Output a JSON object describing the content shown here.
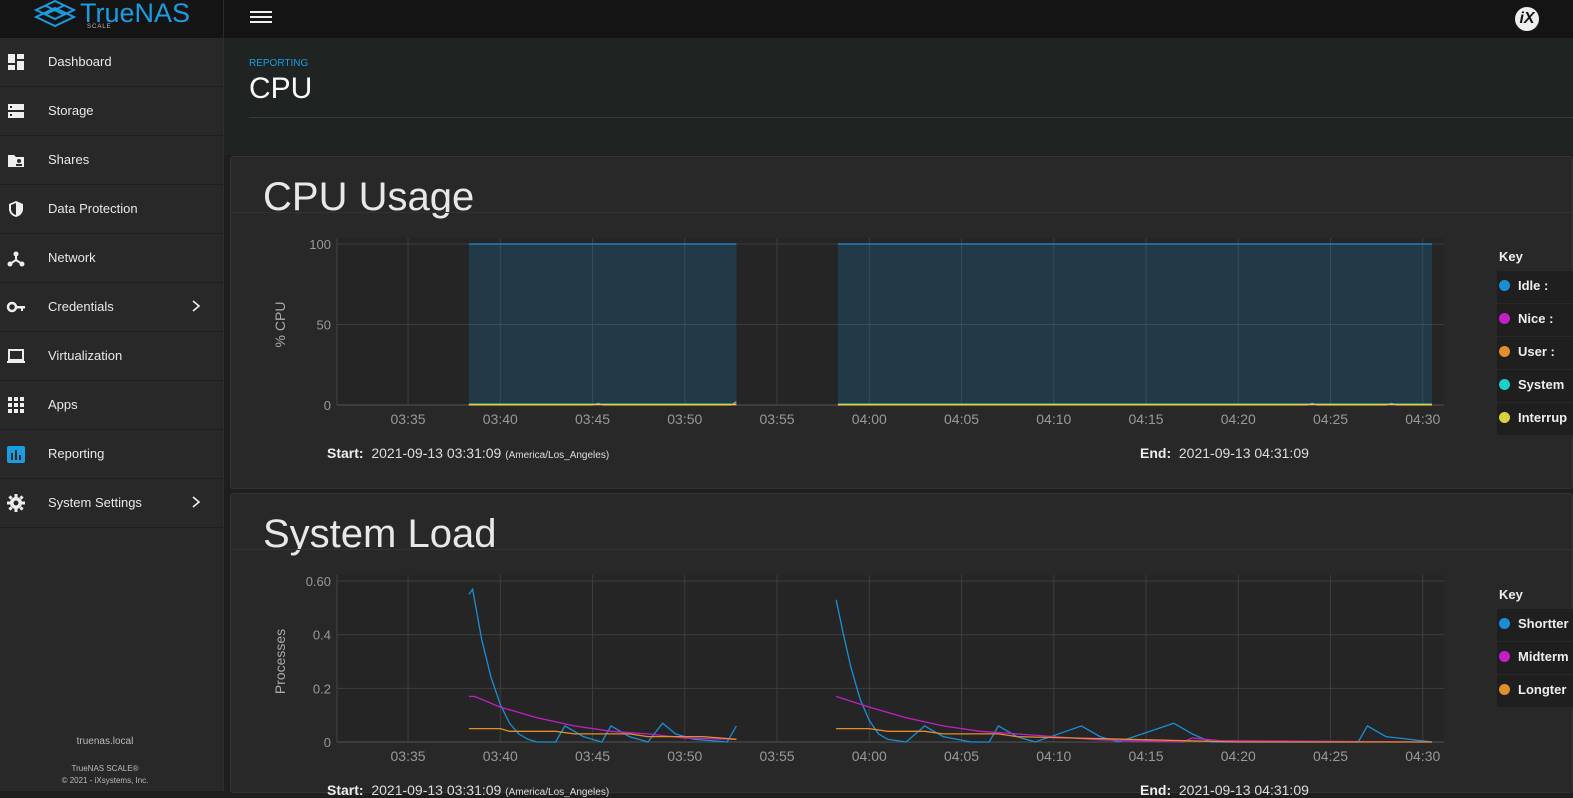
{
  "app": {
    "logo_text": "TrueNAS",
    "logo_sub": "SCALE",
    "vendor_logo": "iX sy"
  },
  "sidebar": {
    "items": [
      {
        "label": "Dashboard",
        "icon": "dashboard-icon"
      },
      {
        "label": "Storage",
        "icon": "storage-icon"
      },
      {
        "label": "Shares",
        "icon": "folder-share-icon"
      },
      {
        "label": "Data Protection",
        "icon": "shield-icon"
      },
      {
        "label": "Network",
        "icon": "network-icon"
      },
      {
        "label": "Credentials",
        "icon": "key-icon",
        "has_children": true
      },
      {
        "label": "Virtualization",
        "icon": "laptop-icon"
      },
      {
        "label": "Apps",
        "icon": "apps-grid-icon"
      },
      {
        "label": "Reporting",
        "icon": "bar-chart-icon",
        "active": true
      },
      {
        "label": "System Settings",
        "icon": "gear-icon",
        "has_children": true
      }
    ],
    "hostname": "truenas.local",
    "version": "TrueNAS SCALE®",
    "copyright": "© 2021 - iXsystems, Inc."
  },
  "header": {
    "breadcrumb": "REPORTING",
    "title": "CPU"
  },
  "colors": {
    "accent": "#1a9de0",
    "idle": "#1a8fd6",
    "nice": "#c21fc4",
    "user": "#e08f2c",
    "system": "#1ccfc9",
    "interrupt": "#d8d33a"
  },
  "cpu_card": {
    "title": "CPU Usage",
    "key_title": "Key",
    "keys": [
      {
        "label": "Idle :",
        "color": "#1a8fd6"
      },
      {
        "label": "Nice :",
        "color": "#c21fc4"
      },
      {
        "label": "User :",
        "color": "#e08f2c"
      },
      {
        "label": "System",
        "color": "#1ccfc9"
      },
      {
        "label": "Interrup",
        "color": "#d8d33a"
      }
    ],
    "start_label": "Start:",
    "start_value": "2021-09-13 03:31:09",
    "start_tz": "(America/Los_Angeles)",
    "end_label": "End:",
    "end_value": "2021-09-13 04:31:09"
  },
  "load_card": {
    "title": "System Load",
    "key_title": "Key",
    "keys": [
      {
        "label": "Shortter",
        "color": "#1a8fd6"
      },
      {
        "label": "Midterm",
        "color": "#c21fc4"
      },
      {
        "label": "Longter",
        "color": "#e08f2c"
      }
    ],
    "start_label": "Start:",
    "start_value": "2021-09-13 03:31:09",
    "start_tz": "(America/Los_Angeles)",
    "end_label": "End:",
    "end_value": "2021-09-13 04:31:09"
  },
  "chart_data": [
    {
      "type": "area",
      "title": "CPU Usage",
      "ylabel": "% CPU",
      "xlabel": "",
      "ylim": [
        0,
        100
      ],
      "yticks": [
        "100",
        "50",
        "0"
      ],
      "ytick_values": [
        100,
        50,
        0
      ],
      "xticks": [
        "03:35",
        "03:40",
        "03:45",
        "03:50",
        "03:55",
        "04:00",
        "04:05",
        "04:10",
        "04:15",
        "04:20",
        "04:25",
        "04:30"
      ],
      "xlim_minutes": [
        31.15,
        91.15
      ],
      "grid": true,
      "series": [
        {
          "name": "Idle",
          "color": "#1a8fd6",
          "segments": [
            [
              [
                38.3,
                100
              ],
              [
                52.8,
                100
              ]
            ],
            [
              [
                58.3,
                100
              ],
              [
                90.5,
                100
              ]
            ]
          ]
        },
        {
          "name": "Nice",
          "color": "#c21fc4",
          "segments": [
            [
              [
                38.3,
                0
              ],
              [
                52.8,
                0
              ]
            ],
            [
              [
                58.3,
                0
              ],
              [
                90.5,
                0
              ]
            ]
          ]
        },
        {
          "name": "User",
          "color": "#e08f2c",
          "segments": [
            [
              [
                38.3,
                0
              ],
              [
                45.0,
                0
              ],
              [
                45.3,
                1
              ],
              [
                45.6,
                0
              ],
              [
                52.5,
                0
              ],
              [
                52.8,
                2
              ]
            ],
            [
              [
                58.3,
                0
              ],
              [
                83.7,
                0
              ],
              [
                84.0,
                1
              ],
              [
                84.3,
                0
              ],
              [
                88.0,
                0
              ],
              [
                88.3,
                1
              ],
              [
                88.6,
                0
              ],
              [
                90.5,
                0
              ]
            ]
          ]
        },
        {
          "name": "System",
          "color": "#1ccfc9",
          "segments": [
            [
              [
                38.3,
                0.5
              ],
              [
                52.8,
                0.5
              ]
            ],
            [
              [
                58.3,
                0.5
              ],
              [
                90.5,
                0.5
              ]
            ]
          ]
        },
        {
          "name": "Interrupt",
          "color": "#d8d33a",
          "segments": [
            [
              [
                38.3,
                0.3
              ],
              [
                52.8,
                0.3
              ]
            ],
            [
              [
                58.3,
                0.3
              ],
              [
                90.5,
                0.3
              ]
            ]
          ]
        }
      ]
    },
    {
      "type": "line",
      "title": "System Load",
      "ylabel": "Processes",
      "xlabel": "",
      "ylim": [
        0,
        0.6
      ],
      "yticks": [
        "0.60",
        "0.4",
        "0.2",
        "0"
      ],
      "ytick_values": [
        0.6,
        0.4,
        0.2,
        0
      ],
      "xticks": [
        "03:35",
        "03:40",
        "03:45",
        "03:50",
        "03:55",
        "04:00",
        "04:05",
        "04:10",
        "04:15",
        "04:20",
        "04:25",
        "04:30"
      ],
      "xlim_minutes": [
        31.15,
        91.15
      ],
      "grid": true,
      "series": [
        {
          "name": "Shortterm",
          "color": "#1a8fd6",
          "segments": [
            [
              [
                38.3,
                0.55
              ],
              [
                38.5,
                0.57
              ],
              [
                39.0,
                0.38
              ],
              [
                39.5,
                0.24
              ],
              [
                40.0,
                0.14
              ],
              [
                40.5,
                0.07
              ],
              [
                41.0,
                0.03
              ],
              [
                41.5,
                0.01
              ],
              [
                42.0,
                0.0
              ],
              [
                43.0,
                0.0
              ],
              [
                43.5,
                0.06
              ],
              [
                44.5,
                0.02
              ],
              [
                45.5,
                0.0
              ],
              [
                46.0,
                0.06
              ],
              [
                47.0,
                0.02
              ],
              [
                48.0,
                0.0
              ],
              [
                48.8,
                0.07
              ],
              [
                49.5,
                0.03
              ],
              [
                50.5,
                0.01
              ],
              [
                52.3,
                0.0
              ],
              [
                52.8,
                0.06
              ]
            ],
            [
              [
                58.2,
                0.53
              ],
              [
                58.6,
                0.4
              ],
              [
                59.0,
                0.28
              ],
              [
                59.5,
                0.16
              ],
              [
                60.0,
                0.08
              ],
              [
                60.5,
                0.03
              ],
              [
                61.0,
                0.01
              ],
              [
                62.0,
                0.0
              ],
              [
                63.0,
                0.06
              ],
              [
                64.0,
                0.02
              ],
              [
                65.5,
                0.0
              ],
              [
                66.5,
                0.0
              ],
              [
                67.0,
                0.06
              ],
              [
                68.0,
                0.02
              ],
              [
                69.0,
                0.0
              ],
              [
                71.5,
                0.06
              ],
              [
                72.5,
                0.02
              ],
              [
                73.5,
                0.0
              ],
              [
                76.5,
                0.07
              ],
              [
                77.5,
                0.03
              ],
              [
                78.5,
                0.0
              ],
              [
                86.5,
                0.0
              ],
              [
                87.0,
                0.06
              ],
              [
                88.0,
                0.02
              ],
              [
                90.5,
                0.0
              ]
            ]
          ]
        },
        {
          "name": "Midterm",
          "color": "#c21fc4",
          "segments": [
            [
              [
                38.3,
                0.17
              ],
              [
                38.6,
                0.17
              ],
              [
                40.0,
                0.13
              ],
              [
                42.0,
                0.09
              ],
              [
                44.0,
                0.06
              ],
              [
                46.0,
                0.04
              ],
              [
                48.0,
                0.03
              ],
              [
                50.0,
                0.015
              ],
              [
                52.8,
                0.01
              ]
            ],
            [
              [
                58.2,
                0.17
              ],
              [
                60.0,
                0.13
              ],
              [
                62.0,
                0.09
              ],
              [
                64.0,
                0.06
              ],
              [
                66.0,
                0.04
              ],
              [
                68.0,
                0.03
              ],
              [
                70.0,
                0.02
              ],
              [
                72.0,
                0.01
              ],
              [
                74.0,
                0.005
              ],
              [
                77.0,
                0.0
              ],
              [
                77.5,
                0.015
              ],
              [
                79.0,
                0.005
              ],
              [
                90.5,
                0.0
              ]
            ]
          ]
        },
        {
          "name": "Longterm",
          "color": "#e08f2c",
          "segments": [
            [
              [
                38.3,
                0.05
              ],
              [
                40.0,
                0.05
              ],
              [
                40.5,
                0.04
              ],
              [
                43.0,
                0.04
              ],
              [
                44.0,
                0.03
              ],
              [
                47.0,
                0.03
              ],
              [
                48.0,
                0.02
              ],
              [
                51.0,
                0.02
              ],
              [
                52.8,
                0.01
              ]
            ],
            [
              [
                58.2,
                0.05
              ],
              [
                60.0,
                0.05
              ],
              [
                61.0,
                0.04
              ],
              [
                63.0,
                0.04
              ],
              [
                64.0,
                0.03
              ],
              [
                67.0,
                0.03
              ],
              [
                68.0,
                0.02
              ],
              [
                71.0,
                0.015
              ],
              [
                74.0,
                0.01
              ],
              [
                77.0,
                0.005
              ],
              [
                80.0,
                0.0
              ],
              [
                90.5,
                0.0
              ]
            ]
          ]
        }
      ]
    }
  ]
}
